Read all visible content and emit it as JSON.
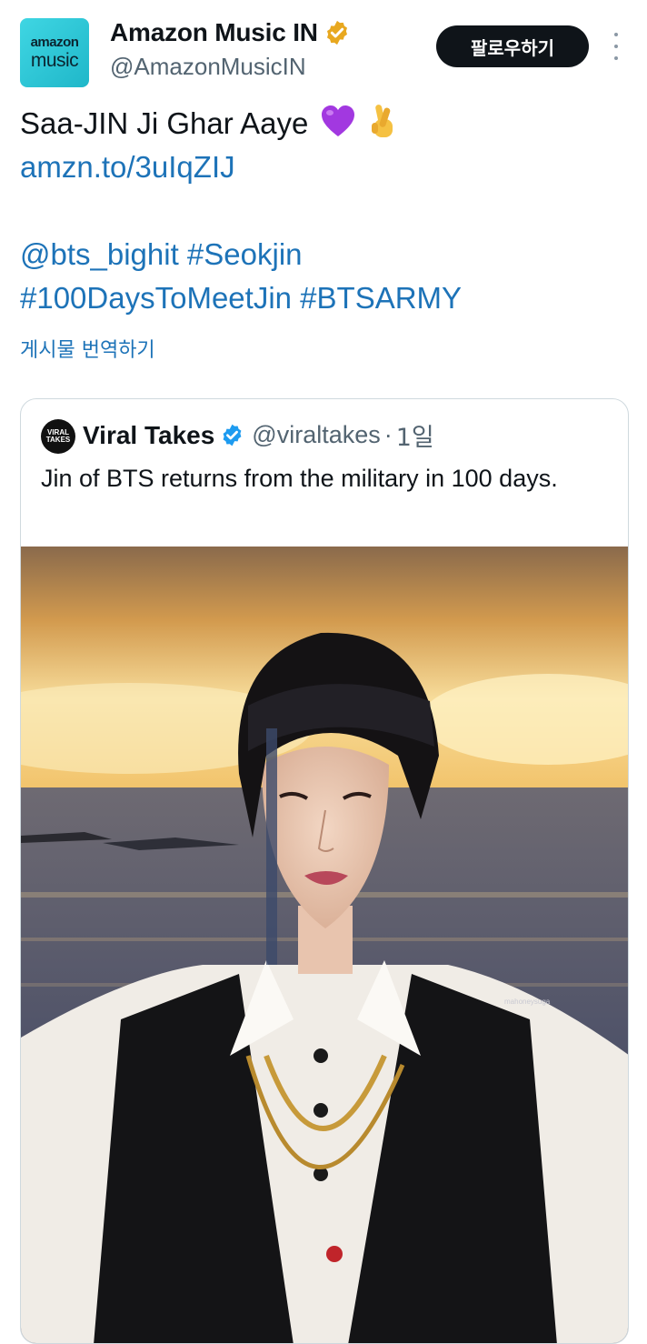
{
  "author": {
    "display_name": "Amazon Music IN",
    "handle": "@AmazonMusicIN",
    "avatar_line1": "amazon",
    "avatar_line2": "music",
    "verified_color": "#e8a820"
  },
  "follow_label": "팔로우하기",
  "tweet": {
    "line1": "Saa-JIN Ji Ghar Aaye",
    "link": "amzn.to/3uIqZIJ",
    "line3": "@bts_bighit #Seokjin",
    "line4": "#100DaysToMeetJin #BTSARMY",
    "emojis": [
      "purple-heart-icon",
      "crossed-fingers-icon"
    ]
  },
  "translate_label": "게시물 번역하기",
  "quote": {
    "display_name": "Viral Takes",
    "handle": "@viraltakes",
    "separator": "·",
    "time": "1일",
    "text": "Jin of BTS returns from the military in 100 days.",
    "avatar_text": "VIRAL TAKES",
    "verified_color": "#1d9bf0",
    "photo_watermark": "mahoneysuga"
  }
}
